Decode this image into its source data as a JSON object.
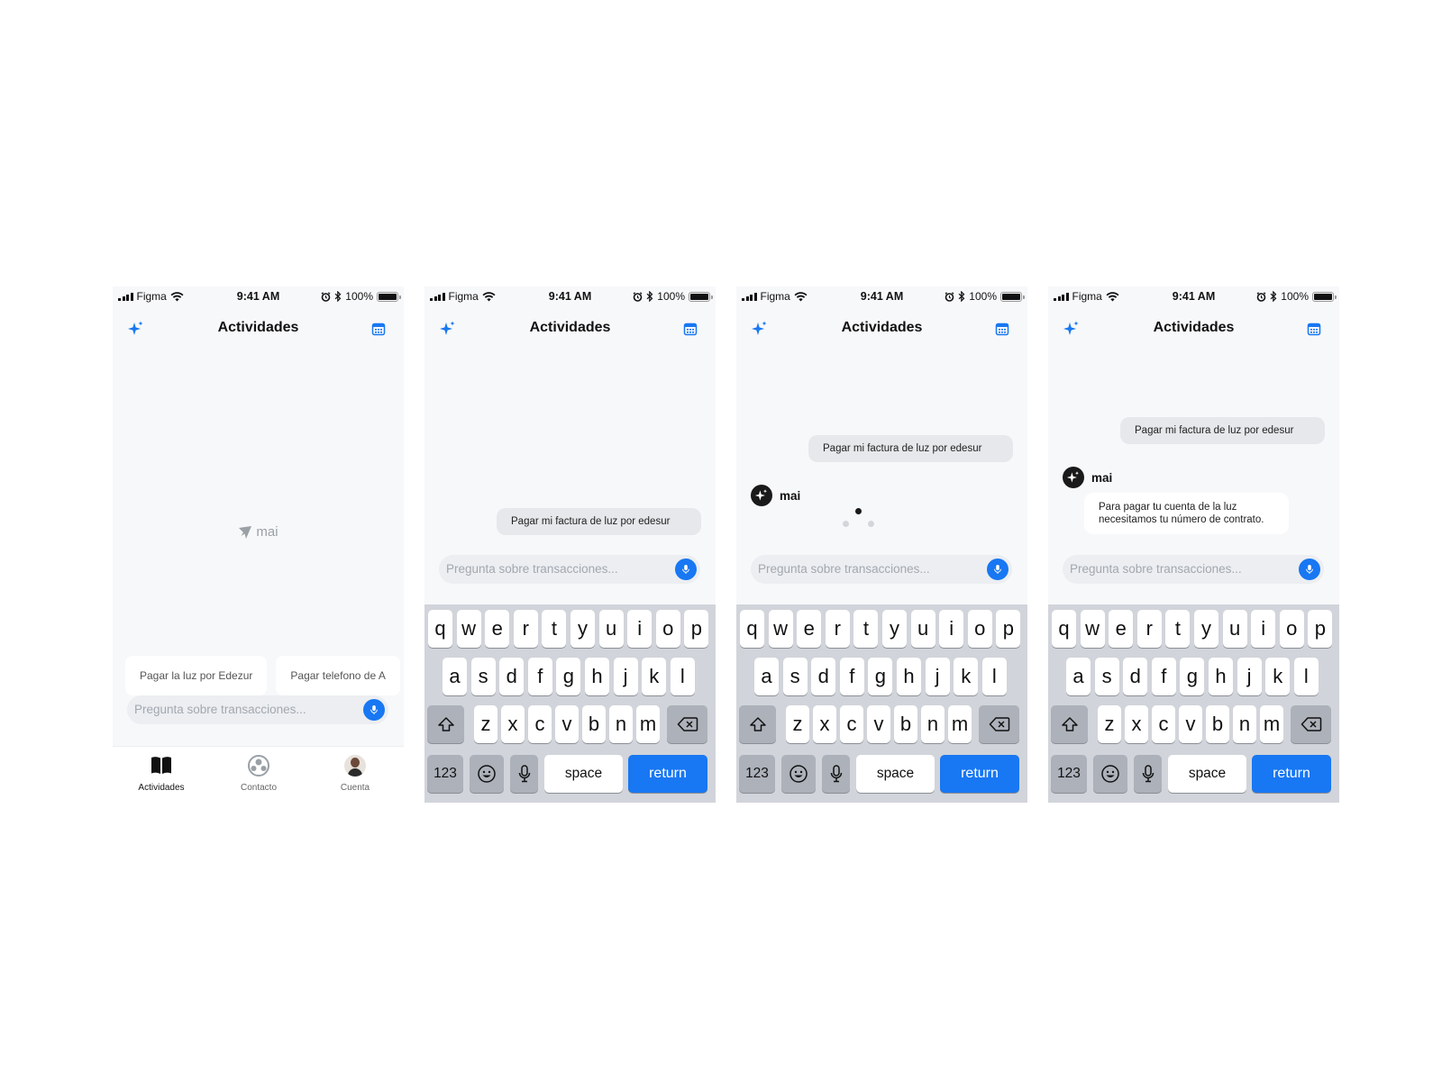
{
  "status": {
    "carrier": "Figma",
    "time": "9:41 AM",
    "battery": "100%"
  },
  "nav": {
    "title": "Actividades"
  },
  "empty": {
    "logo_text": "mai"
  },
  "suggestions": [
    "Pagar la luz por Edezur",
    "Pagar telefono de A"
  ],
  "input": {
    "placeholder": "Pregunta sobre transacciones..."
  },
  "tabs": [
    {
      "label": "Actividades",
      "icon": "book-icon",
      "active": true
    },
    {
      "label": "Contacto",
      "icon": "contact-icon",
      "active": false
    },
    {
      "label": "Cuenta",
      "icon": "avatar",
      "active": false
    }
  ],
  "keyboard": {
    "row1": [
      "q",
      "w",
      "e",
      "r",
      "t",
      "y",
      "u",
      "i",
      "o",
      "p"
    ],
    "row2": [
      "a",
      "s",
      "d",
      "f",
      "g",
      "h",
      "j",
      "k",
      "l"
    ],
    "row3": [
      "z",
      "x",
      "c",
      "v",
      "b",
      "n",
      "m"
    ],
    "numbers_label": "123",
    "space_label": "space",
    "return_label": "return"
  },
  "chat": {
    "user_message": "Pagar mi factura de luz por edesur",
    "assistant_name": "mai",
    "assistant_reply": "Para pagar tu cuenta de la luz necesitamos tu número de contrato."
  },
  "colors": {
    "accent": "#1877f2",
    "background": "#f7f8fa",
    "keyboard": "#d1d4da"
  }
}
